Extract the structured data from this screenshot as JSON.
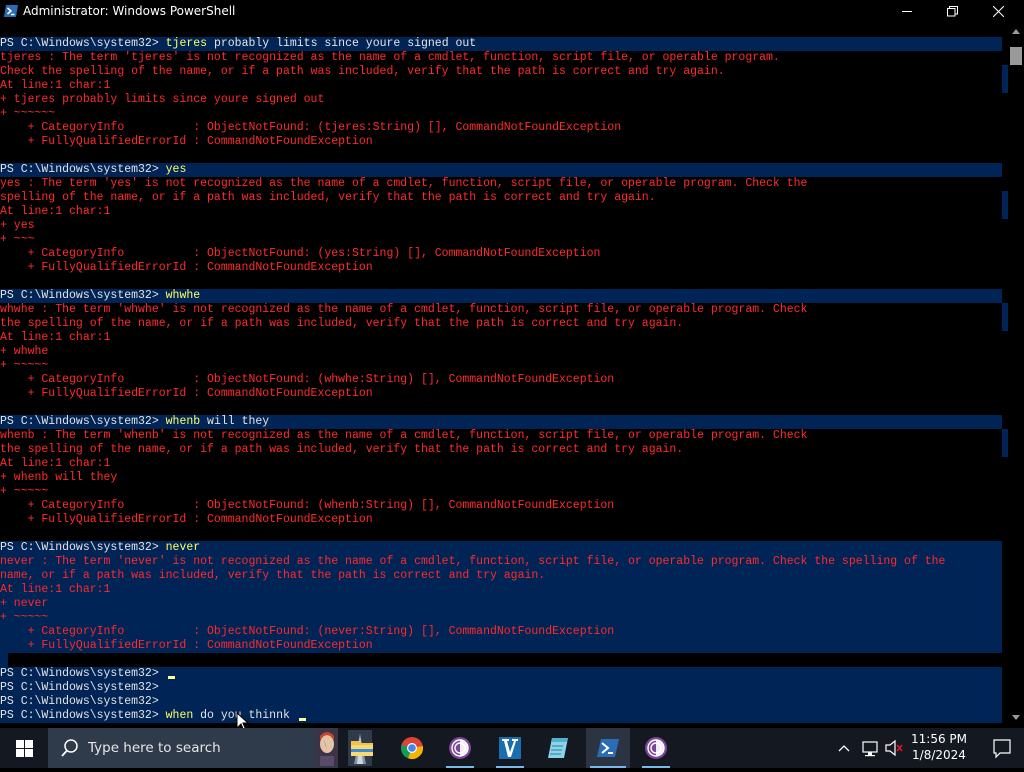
{
  "window": {
    "title": "Administrator: Windows PowerShell"
  },
  "console": {
    "lines": [
      {
        "row": 0,
        "kind": "prompt",
        "prompt": "PS C:\\Windows\\system32> ",
        "cmd": "tjeres",
        "args": " probably limits since youre signed out"
      },
      {
        "row": 1,
        "kind": "err",
        "text": "tjeres : The term 'tjeres' is not recognized as the name of a cmdlet, function, script file, or operable program."
      },
      {
        "row": 2,
        "kind": "err",
        "text": "Check the spelling of the name, or if a path was included, verify that the path is correct and try again."
      },
      {
        "row": 3,
        "kind": "err",
        "text": "At line:1 char:1"
      },
      {
        "row": 4,
        "kind": "err",
        "text": "+ tjeres probably limits since youre signed out"
      },
      {
        "row": 5,
        "kind": "err",
        "text": "+ ~~~~~~"
      },
      {
        "row": 6,
        "kind": "err",
        "text": "    + CategoryInfo          : ObjectNotFound: (tjeres:String) [], CommandNotFoundException"
      },
      {
        "row": 7,
        "kind": "err",
        "text": "    + FullyQualifiedErrorId : CommandNotFoundException"
      },
      {
        "row": 8,
        "kind": "blank",
        "text": ""
      },
      {
        "row": 9,
        "kind": "prompt",
        "prompt": "PS C:\\Windows\\system32> ",
        "cmd": "yes",
        "args": ""
      },
      {
        "row": 10,
        "kind": "err",
        "text": "yes : The term 'yes' is not recognized as the name of a cmdlet, function, script file, or operable program. Check the"
      },
      {
        "row": 11,
        "kind": "err",
        "text": "spelling of the name, or if a path was included, verify that the path is correct and try again."
      },
      {
        "row": 12,
        "kind": "err",
        "text": "At line:1 char:1"
      },
      {
        "row": 13,
        "kind": "err",
        "text": "+ yes"
      },
      {
        "row": 14,
        "kind": "err",
        "text": "+ ~~~"
      },
      {
        "row": 15,
        "kind": "err",
        "text": "    + CategoryInfo          : ObjectNotFound: (yes:String) [], CommandNotFoundException"
      },
      {
        "row": 16,
        "kind": "err",
        "text": "    + FullyQualifiedErrorId : CommandNotFoundException"
      },
      {
        "row": 17,
        "kind": "blank",
        "text": ""
      },
      {
        "row": 18,
        "kind": "prompt",
        "prompt": "PS C:\\Windows\\system32> ",
        "cmd": "whwhe",
        "args": ""
      },
      {
        "row": 19,
        "kind": "err",
        "text": "whwhe : The term 'whwhe' is not recognized as the name of a cmdlet, function, script file, or operable program. Check"
      },
      {
        "row": 20,
        "kind": "err",
        "text": "the spelling of the name, or if a path was included, verify that the path is correct and try again."
      },
      {
        "row": 21,
        "kind": "err",
        "text": "At line:1 char:1"
      },
      {
        "row": 22,
        "kind": "err",
        "text": "+ whwhe"
      },
      {
        "row": 23,
        "kind": "err",
        "text": "+ ~~~~~"
      },
      {
        "row": 24,
        "kind": "err",
        "text": "    + CategoryInfo          : ObjectNotFound: (whwhe:String) [], CommandNotFoundException"
      },
      {
        "row": 25,
        "kind": "err",
        "text": "    + FullyQualifiedErrorId : CommandNotFoundException"
      },
      {
        "row": 26,
        "kind": "blank",
        "text": ""
      },
      {
        "row": 27,
        "kind": "prompt",
        "prompt": "PS C:\\Windows\\system32> ",
        "cmd": "whenb",
        "args": " will they"
      },
      {
        "row": 28,
        "kind": "err",
        "text": "whenb : The term 'whenb' is not recognized as the name of a cmdlet, function, script file, or operable program. Check"
      },
      {
        "row": 29,
        "kind": "err",
        "text": "the spelling of the name, or if a path was included, verify that the path is correct and try again."
      },
      {
        "row": 30,
        "kind": "err",
        "text": "At line:1 char:1"
      },
      {
        "row": 31,
        "kind": "err",
        "text": "+ whenb will they"
      },
      {
        "row": 32,
        "kind": "err",
        "text": "+ ~~~~~"
      },
      {
        "row": 33,
        "kind": "err",
        "text": "    + CategoryInfo          : ObjectNotFound: (whenb:String) [], CommandNotFoundException"
      },
      {
        "row": 34,
        "kind": "err",
        "text": "    + FullyQualifiedErrorId : CommandNotFoundException"
      },
      {
        "row": 35,
        "kind": "blank",
        "text": ""
      },
      {
        "row": 36,
        "kind": "prompt",
        "prompt": "PS C:\\Windows\\system32> ",
        "cmd": "never",
        "args": ""
      },
      {
        "row": 37,
        "kind": "err",
        "text": "never : The term 'never' is not recognized as the name of a cmdlet, function, script file, or operable program. Check the spelling of the"
      },
      {
        "row": 38,
        "kind": "err",
        "text": "name, or if a path was included, verify that the path is correct and try again."
      },
      {
        "row": 39,
        "kind": "err",
        "text": "At line:1 char:1"
      },
      {
        "row": 40,
        "kind": "err",
        "text": "+ never"
      },
      {
        "row": 41,
        "kind": "err",
        "text": "+ ~~~~~"
      },
      {
        "row": 42,
        "kind": "err",
        "text": "    + CategoryInfo          : ObjectNotFound: (never:String) [], CommandNotFoundException"
      },
      {
        "row": 43,
        "kind": "err",
        "text": "    + FullyQualifiedErrorId : CommandNotFoundException"
      },
      {
        "row": 44,
        "kind": "blank",
        "text": ""
      },
      {
        "row": 45,
        "kind": "prompt",
        "prompt": "PS C:\\Windows\\system32> ",
        "cmd": "",
        "args": "",
        "cursor": true
      },
      {
        "row": 46,
        "kind": "prompt",
        "prompt": "PS C:\\Windows\\system32>",
        "cmd": "",
        "args": ""
      },
      {
        "row": 47,
        "kind": "prompt",
        "prompt": "PS C:\\Windows\\system32>",
        "cmd": "",
        "args": ""
      },
      {
        "row": 48,
        "kind": "prompt",
        "prompt": "PS C:\\Windows\\system32> ",
        "cmd": "when",
        "args": " do you thinnk ",
        "cursor": true
      }
    ]
  },
  "taskbar": {
    "search_placeholder": "Type here to search",
    "time": "11:56 PM",
    "date": "1/8/2024",
    "apps": [
      {
        "name": "file-explorer",
        "icon": "folder-icon"
      },
      {
        "name": "chrome",
        "icon": "chrome-icon"
      },
      {
        "name": "tor-browser-1",
        "icon": "tor-icon"
      },
      {
        "name": "vim",
        "icon": "vim-icon"
      },
      {
        "name": "notepad",
        "icon": "notepad-icon"
      },
      {
        "name": "powershell",
        "icon": "powershell-icon"
      },
      {
        "name": "tor-browser-2",
        "icon": "tor-icon"
      }
    ]
  },
  "colors": {
    "console_bg": "#000000",
    "prompt_bg": "#012456",
    "error_text": "#ff2a2a",
    "command_text": "#ffff66",
    "normal_text": "#e4e4e4"
  }
}
